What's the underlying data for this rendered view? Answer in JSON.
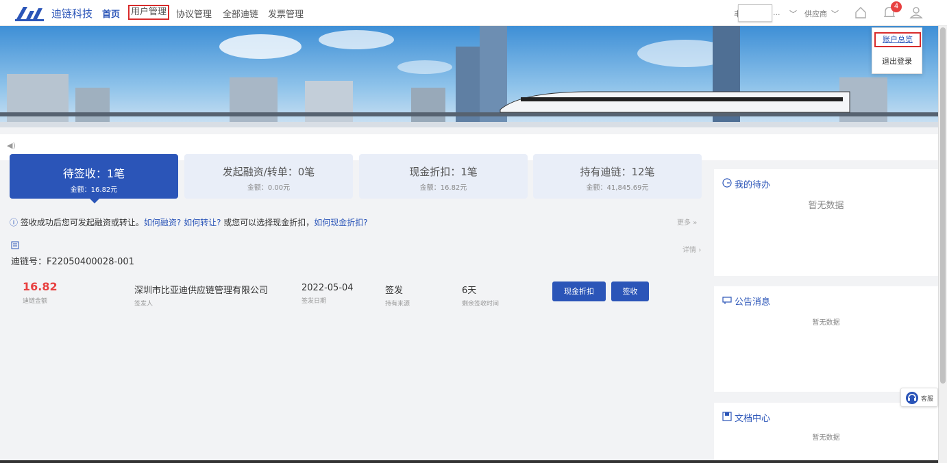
{
  "nav": {
    "brand": "迪链科技",
    "items": [
      {
        "label": "首页"
      },
      {
        "label": "用户管理"
      },
      {
        "label": "协议管理"
      },
      {
        "label": "全部迪链"
      },
      {
        "label": "发票管理"
      }
    ],
    "user_prefix": "丰",
    "user_suffix": "...",
    "role": "供应商",
    "notification_count": "4"
  },
  "dropdown": {
    "items": [
      {
        "label": "账户总览"
      },
      {
        "label": "退出登录"
      }
    ]
  },
  "tabs": [
    {
      "title": "待签收：1笔",
      "sub": "金额：16.82元"
    },
    {
      "title": "发起融资/转单：0笔",
      "sub": "金额：0.00元"
    },
    {
      "title": "现金折扣：1笔",
      "sub": "金额：16.82元"
    },
    {
      "title": "持有迪链：12笔",
      "sub": "金额：41,845.69元"
    }
  ],
  "hint": {
    "prefix": "签收成功后您可发起融资或转让。",
    "link1": "如何融资?",
    "link2": "如何转让?",
    "middle": "或您可以选择现金折扣，",
    "link3": "如何现金折扣?"
  },
  "more_label": "更多",
  "detail_label": "详情",
  "chain": {
    "number_label": "迪链号：F22050400028-001",
    "amount": "16.82",
    "amount_label": "迪链金额",
    "issuer": "深圳市比亚迪供应链管理有限公司",
    "issuer_label": "签发人",
    "issue_date": "2022-05-04",
    "issue_date_label": "签发日期",
    "source": "签发",
    "source_label": "持有来源",
    "remaining": "6天",
    "remaining_label": "剩余签收时间",
    "btn_discount": "现金折扣",
    "btn_sign": "签收"
  },
  "panels": {
    "todo": {
      "title": "我的待办",
      "empty": "暂无数据"
    },
    "notice": {
      "title": "公告消息",
      "empty": "暂无数据"
    },
    "docs": {
      "title": "文档中心",
      "empty": "暂无数据"
    }
  },
  "kefu_label": "客服"
}
